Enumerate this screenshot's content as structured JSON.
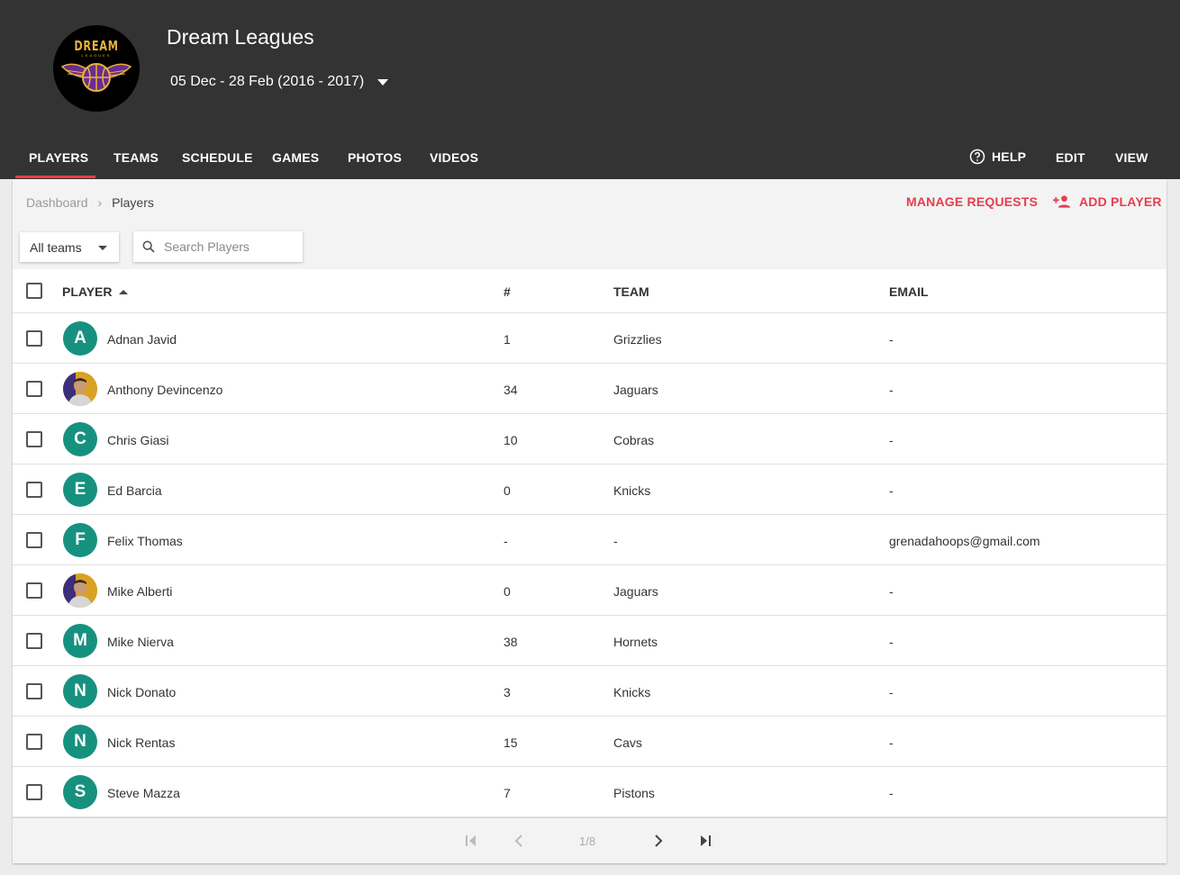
{
  "app": {
    "logo_text": "DREAM",
    "logo_subtext": "LEAGUES",
    "title": "Dream Leagues",
    "season": "05 Dec - 28 Feb (2016 - 2017)"
  },
  "nav": {
    "tabs": [
      {
        "label": "PLAYERS",
        "active": true
      },
      {
        "label": "TEAMS"
      },
      {
        "label": "SCHEDULE"
      },
      {
        "label": "GAMES"
      },
      {
        "label": "PHOTOS"
      },
      {
        "label": "VIDEOS"
      }
    ],
    "help": "HELP",
    "edit": "EDIT",
    "view": "VIEW"
  },
  "breadcrumb": {
    "root": "Dashboard",
    "current": "Players"
  },
  "actions": {
    "manage_requests": "MANAGE REQUESTS",
    "add_player": "ADD PLAYER"
  },
  "filters": {
    "team_select": "All teams",
    "search_placeholder": "Search Players"
  },
  "table": {
    "columns": {
      "player": "PLAYER",
      "number": "#",
      "team": "TEAM",
      "email": "EMAIL"
    },
    "rows": [
      {
        "initial": "A",
        "photo": false,
        "name": "Adnan Javid",
        "number": "1",
        "team": "Grizzlies",
        "email": "-"
      },
      {
        "initial": "",
        "photo": true,
        "name": "Anthony Devincenzo",
        "number": "34",
        "team": "Jaguars",
        "email": "-"
      },
      {
        "initial": "C",
        "photo": false,
        "name": "Chris Giasi",
        "number": "10",
        "team": "Cobras",
        "email": "-"
      },
      {
        "initial": "E",
        "photo": false,
        "name": "Ed Barcia",
        "number": "0",
        "team": "Knicks",
        "email": "-"
      },
      {
        "initial": "F",
        "photo": false,
        "name": "Felix Thomas",
        "number": "-",
        "team": "-",
        "email": "grenadahoops@gmail.com"
      },
      {
        "initial": "",
        "photo": true,
        "name": "Mike Alberti",
        "number": "0",
        "team": "Jaguars",
        "email": "-"
      },
      {
        "initial": "M",
        "photo": false,
        "name": "Mike Nierva",
        "number": "38",
        "team": "Hornets",
        "email": "-"
      },
      {
        "initial": "N",
        "photo": false,
        "name": "Nick Donato",
        "number": "3",
        "team": "Knicks",
        "email": "-"
      },
      {
        "initial": "N",
        "photo": false,
        "name": "Nick Rentas",
        "number": "15",
        "team": "Cavs",
        "email": "-"
      },
      {
        "initial": "S",
        "photo": false,
        "name": "Steve Mazza",
        "number": "7",
        "team": "Pistons",
        "email": "-"
      }
    ]
  },
  "pagination": {
    "label": "1/8"
  },
  "colors": {
    "header_bg": "#333333",
    "accent": "#e53e4e",
    "avatar_bg": "#17917f",
    "logo_gold": "#e8b339",
    "logo_purple": "#6a2c91"
  }
}
